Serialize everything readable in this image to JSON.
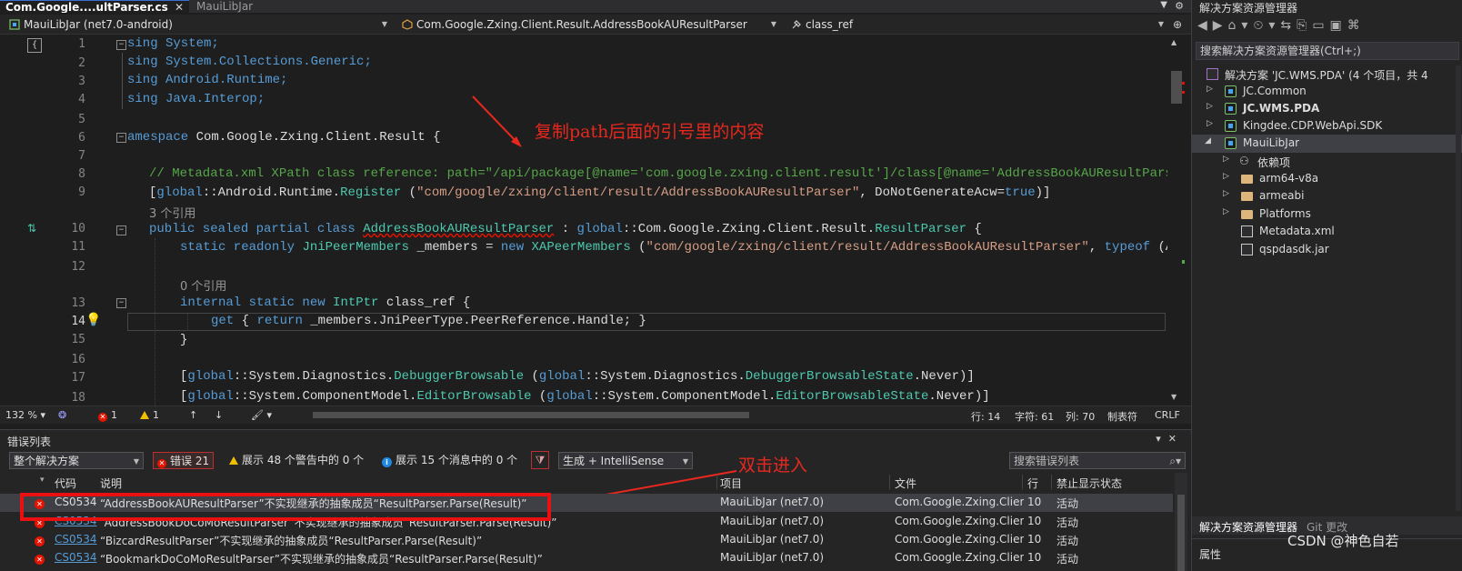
{
  "tabs": {
    "active": "Com.Google....ultParser.cs",
    "inactive": "MauiLibJar"
  },
  "navbar": {
    "project": "MauiLibJar (net7.0-android)",
    "type": "Com.Google.Zxing.Client.Result.AddressBookAUResultParser",
    "member": "class_ref"
  },
  "code": {
    "line_numbers": [
      "1",
      "2",
      "3",
      "4",
      "5",
      "6",
      "7",
      "8",
      "9",
      "10",
      "11",
      "12",
      "13",
      "14",
      "15",
      "16",
      "17",
      "18"
    ],
    "l1": "sing System;",
    "l2": "sing System.Collections.Generic;",
    "l3": "sing Android.Runtime;",
    "l4": "sing Java.Interop;",
    "l6_kw": "amespace",
    "l6_rest": " Com.Google.Zxing.Client.Result {",
    "l8": "// Metadata.xml XPath class reference: path=\"/api/package[@name='com.google.zxing.client.result']/class[@name='AddressBookAUResultPars",
    "l9_a": "[",
    "l9_global": "global",
    "l9_b": "::Android.Runtime.",
    "l9_reg": "Register",
    "l9_c": " (",
    "l9_str": "\"com/google/zxing/client/result/AddressBookAUResultParser\"",
    "l9_d": ", DoNotGenerateAcw=",
    "l9_true": "true",
    "l9_e": ")]",
    "lens_3": "3 个引用",
    "l10_kw": "public sealed partial class",
    "l10_cls": "AddressBookAUResultParser",
    "l10_b": " : ",
    "l10_global": "global",
    "l10_c": "::Com.Google.Zxing.Client.Result.",
    "l10_base": "ResultParser",
    "l10_d": " {",
    "l11_kw": "static readonly",
    "l11_ty": "JniPeerMembers",
    "l11_b": " _members = ",
    "l11_new": "new",
    "l11_ty2": "XAPeerMembers",
    "l11_c": " (",
    "l11_str": "\"com/google/zxing/client/result/AddressBookAUResultParser\"",
    "l11_d": ", ",
    "l11_typeof": "typeof",
    "l11_e": " (A",
    "lens_0": "0 个引用",
    "l13_kw": "internal static new",
    "l13_ty": "IntPtr",
    "l13_rest": " class_ref {",
    "l14_get": "get",
    "l14_a": " { ",
    "l14_ret": "return",
    "l14_b": " _members.JniPeerType.PeerReference.Handle; }",
    "l15": "}",
    "l17_a": "[",
    "l17_global": "global",
    "l17_b": "::System.Diagnostics.",
    "l17_attr": "DebuggerBrowsable",
    "l17_c": " (",
    "l17_global2": "global",
    "l17_d": "::System.Diagnostics.",
    "l17_ty": "DebuggerBrowsableState",
    "l17_e": ".Never)]",
    "l18_a": "[",
    "l18_global": "global",
    "l18_b": "::System.ComponentModel.",
    "l18_attr": "EditorBrowsable",
    "l18_c": " (",
    "l18_global2": "global",
    "l18_d": "::System.ComponentModel.",
    "l18_ty": "EditorBrowsableState",
    "l18_e": ".Never)]"
  },
  "annotations": {
    "copy_hint": "复制path后面的引号里的内容",
    "dblclick_hint": "双击进入"
  },
  "editor_status": {
    "zoom": "132 %",
    "errors": "1",
    "warnings": "1",
    "line": "行: 14",
    "char": "字符: 61",
    "col": "列: 70",
    "tabs": "制表符",
    "eol": "CRLF"
  },
  "error_list": {
    "title": "错误列表",
    "scope": "整个解决方案",
    "errors_btn": "错误 21",
    "warnings_btn": "展示 48 个警告中的 0 个",
    "messages_btn": "展示 15 个消息中的 0 个",
    "build_filter": "生成 + IntelliSense",
    "search_placeholder": "搜索错误列表",
    "columns": {
      "code": "代码",
      "desc": "说明",
      "project": "项目",
      "file": "文件",
      "line": "行",
      "suppress": "禁止显示状态"
    },
    "rows": [
      {
        "code": "CS0534",
        "desc": "“AddressBookAUResultParser”不实现继承的抽象成员“ResultParser.Parse(Result)”",
        "project": "MauiLibJar (net7.0)",
        "file": "Com.Google.Zxing.Clien...",
        "line": "10",
        "state": "活动"
      },
      {
        "code": "CS0534",
        "desc": "“AddressBookDoCoMoResultParser”不实现继承的抽象成员“ResultParser.Parse(Result)”",
        "project": "MauiLibJar (net7.0)",
        "file": "Com.Google.Zxing.Clien...",
        "line": "10",
        "state": "活动"
      },
      {
        "code": "CS0534",
        "desc": "“BizcardResultParser”不实现继承的抽象成员“ResultParser.Parse(Result)”",
        "project": "MauiLibJar (net7.0)",
        "file": "Com.Google.Zxing.Clien...",
        "line": "10",
        "state": "活动"
      },
      {
        "code": "CS0534",
        "desc": "“BookmarkDoCoMoResultParser”不实现继承的抽象成员“ResultParser.Parse(Result)”",
        "project": "MauiLibJar (net7.0)",
        "file": "Com.Google.Zxing.Clien...",
        "line": "10",
        "state": "活动"
      }
    ]
  },
  "solution_explorer": {
    "title": "解决方案资源管理器",
    "search_placeholder": "搜索解决方案资源管理器(Ctrl+;)",
    "solution": "解决方案 'JC.WMS.PDA' (4 个项目，共 4",
    "items": [
      {
        "label": "JC.Common",
        "icon": "project-icon"
      },
      {
        "label": "JC.WMS.PDA",
        "icon": "project-icon"
      },
      {
        "label": "Kingdee.CDP.WebApi.SDK",
        "icon": "project-icon"
      },
      {
        "label": "MauiLibJar",
        "icon": "project-icon"
      },
      {
        "label": "依赖项",
        "icon": "dependencies-icon"
      },
      {
        "label": "arm64-v8a",
        "icon": "folder-icon"
      },
      {
        "label": "armeabi",
        "icon": "folder-icon"
      },
      {
        "label": "Platforms",
        "icon": "folder-icon"
      },
      {
        "label": "Metadata.xml",
        "icon": "xml-file-icon"
      },
      {
        "label": "qspdasdk.jar",
        "icon": "jar-file-icon"
      }
    ],
    "bottom_tabs": [
      "解决方案资源管理器",
      "Git 更改"
    ],
    "properties": "属性"
  },
  "watermark": "CSDN @神色自若",
  "colors": {
    "keyword": "#569cd6",
    "type": "#4ec9b0",
    "string": "#d69d85",
    "comment": "#57a64a",
    "annotation": "#e8281e"
  }
}
